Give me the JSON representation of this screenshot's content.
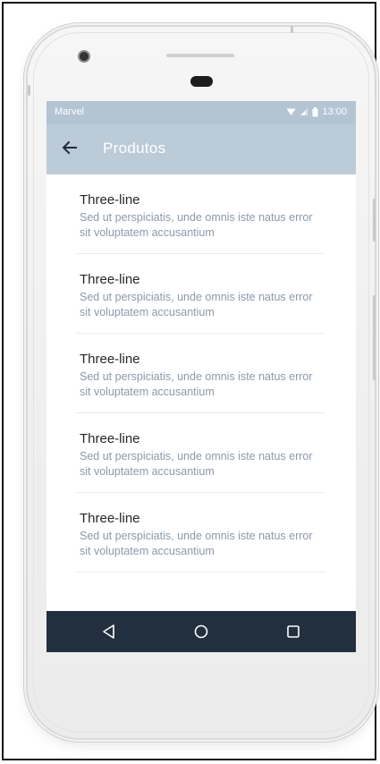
{
  "status_bar": {
    "carrier": "Marvel",
    "time": "13:00",
    "icons": [
      "wifi-icon",
      "signal-icon",
      "battery-icon"
    ]
  },
  "app_bar": {
    "title": "Produtos",
    "back_icon": "arrow-left-icon"
  },
  "list": {
    "items": [
      {
        "title": "Three-line",
        "subtitle": "Sed ut perspiciatis, unde omnis iste natus error sit voluptatem accusantium"
      },
      {
        "title": "Three-line",
        "subtitle": "Sed ut perspiciatis, unde omnis iste natus error sit voluptatem accusantium"
      },
      {
        "title": "Three-line",
        "subtitle": "Sed ut perspiciatis, unde omnis iste natus error sit voluptatem accusantium"
      },
      {
        "title": "Three-line",
        "subtitle": "Sed ut perspiciatis, unde omnis iste natus error sit voluptatem accusantium"
      },
      {
        "title": "Three-line",
        "subtitle": "Sed ut perspiciatis, unde omnis iste natus error sit voluptatem accusantium"
      }
    ]
  },
  "nav_bar": {
    "buttons": [
      "back-triangle-icon",
      "home-circle-icon",
      "recents-square-icon"
    ]
  },
  "colors": {
    "app_bar": "#bccbd8",
    "status_bar": "#b3c4d3",
    "nav_bar": "#222f3e",
    "subtitle_text": "#8a9aac",
    "title_text": "#23272b"
  }
}
